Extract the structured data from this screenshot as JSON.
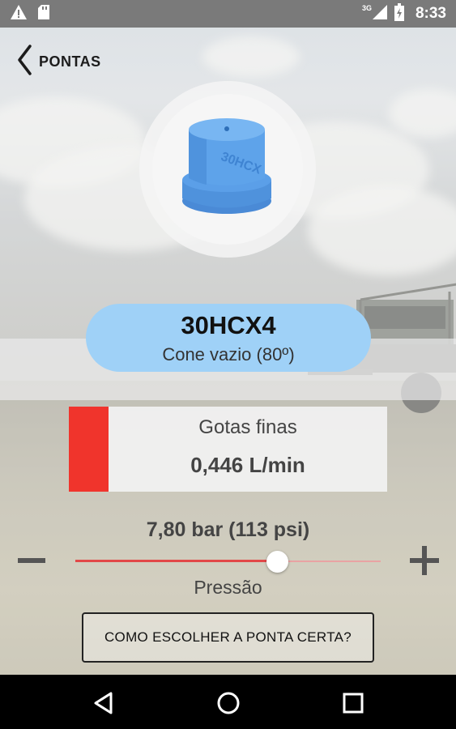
{
  "status_bar": {
    "time": "8:33",
    "network": "3G",
    "icons": [
      "warning-icon",
      "sd-card-icon",
      "signal-icon",
      "battery-icon"
    ]
  },
  "nav": {
    "back_label": "PONTAS"
  },
  "nozzle": {
    "code": "30HCX4",
    "type": "Cone vazio (80º)",
    "body_color": "#5a9fe6"
  },
  "result": {
    "droplet_class": "Gotas finas",
    "flow": "0,446 L/min",
    "droplet_color": "#f0342c"
  },
  "pressure": {
    "value_text": "7,80 bar (113 psi)",
    "label": "Pressão",
    "slider_fraction": 0.66
  },
  "help_button": {
    "label": "COMO ESCOLHER A PONTA CERTA?"
  },
  "colors": {
    "pill": "#9fd1f7",
    "slider_accent": "#e24848"
  }
}
